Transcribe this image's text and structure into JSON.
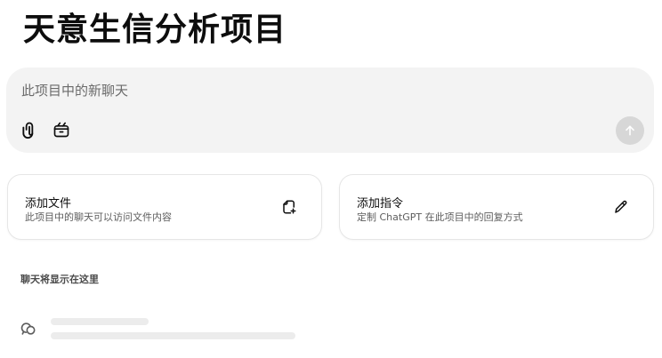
{
  "project": {
    "title": "天意生信分析项目"
  },
  "composer": {
    "placeholder": "此项目中的新聊天",
    "attach_icon": "paperclip-icon",
    "scan_icon": "clipboard-scan-icon",
    "send_icon": "arrow-up-icon"
  },
  "cards": {
    "add_file": {
      "title": "添加文件",
      "description": "此项目中的聊天可以访问文件内容",
      "icon": "file-plus-icon"
    },
    "add_instructions": {
      "title": "添加指令",
      "description": "定制 ChatGPT 在此项目中的回复方式",
      "icon": "pencil-icon"
    }
  },
  "chats": {
    "section_label": "聊天将显示在这里",
    "placeholder_icon": "chat-bubbles-icon"
  },
  "colors": {
    "composer_bg": "#f3f3f3",
    "send_button_disabled": "#d7d7d7",
    "skeleton": "#ececec",
    "card_border": "#e6e6e6"
  }
}
